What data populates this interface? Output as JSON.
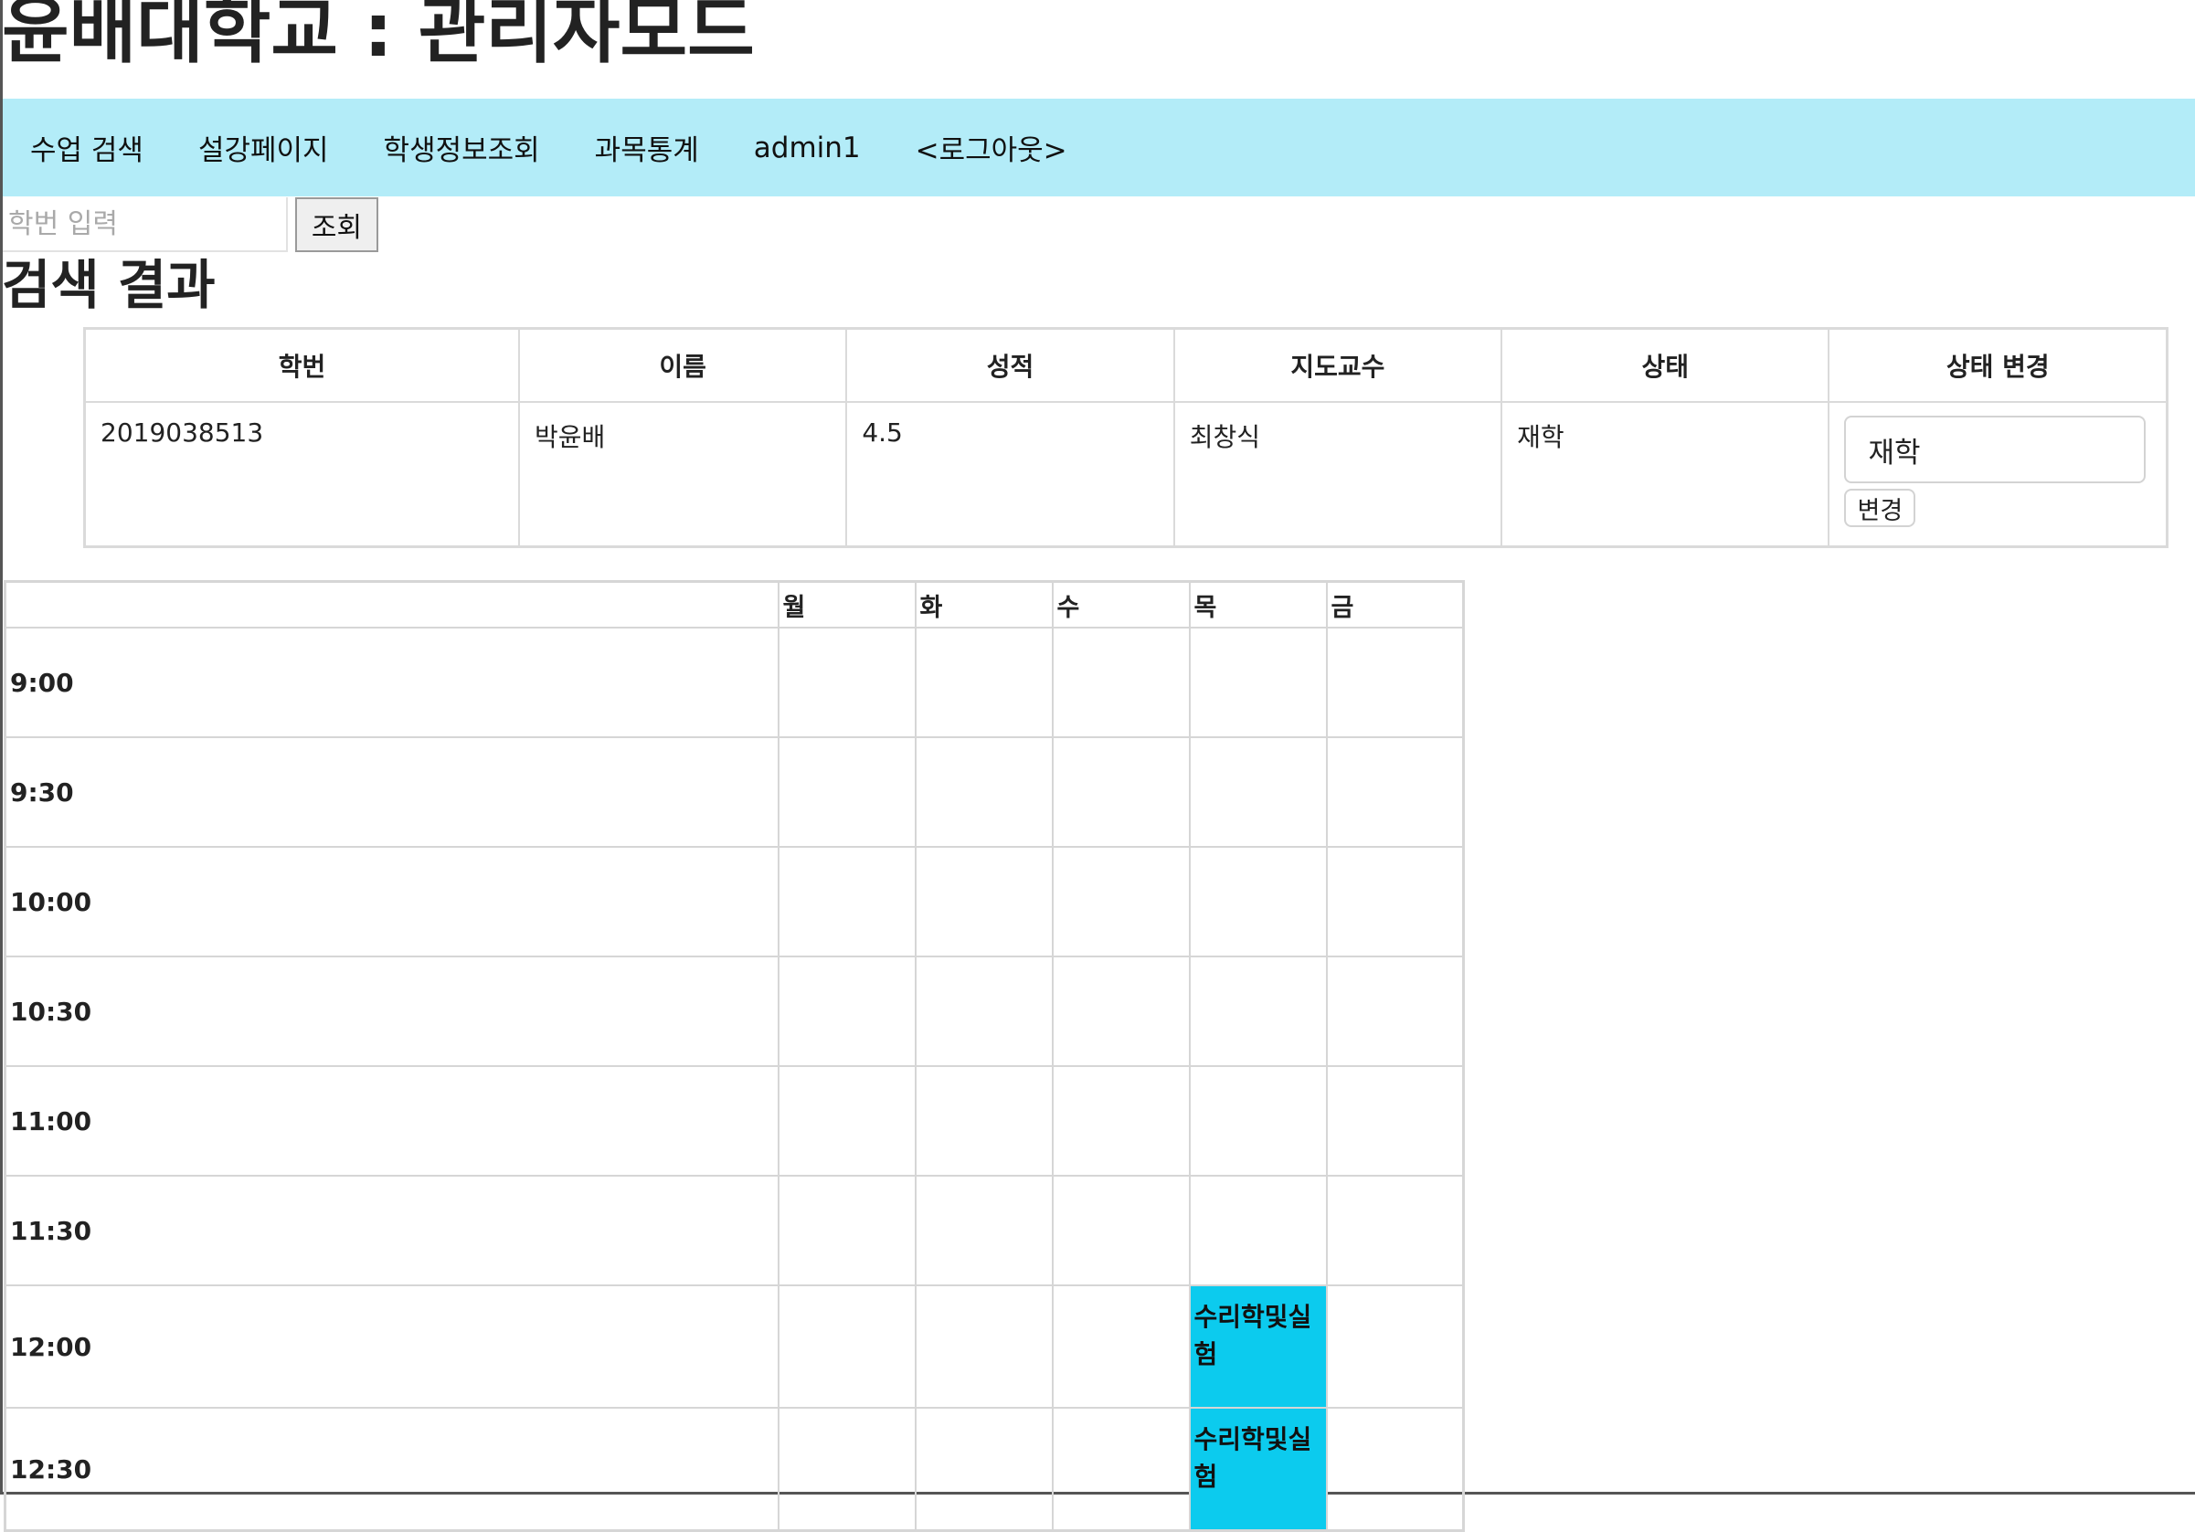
{
  "site_title": "윤배대학교 : 관리자모드",
  "nav": {
    "items": [
      "수업 검색",
      "설강페이지",
      "학생정보조회",
      "과목통계",
      "admin1",
      "<로그아웃>"
    ]
  },
  "search": {
    "placeholder": "학번 입력",
    "button_label": "조회"
  },
  "result_heading": "검색 결과",
  "student_table": {
    "headers": [
      "학번",
      "이름",
      "성적",
      "지도교수",
      "상태",
      "상태 변경"
    ],
    "row": {
      "student_id": "2019038513",
      "name": "박윤배",
      "grade": "4.5",
      "advisor": "최창식",
      "status": "재학",
      "status_field_value": "재학",
      "change_button": "변경"
    }
  },
  "timetable": {
    "days": [
      "월",
      "화",
      "수",
      "목",
      "금"
    ],
    "times": [
      "9:00",
      "9:30",
      "10:00",
      "10:30",
      "11:00",
      "11:30",
      "12:00",
      "12:30"
    ],
    "classes": [
      {
        "day": "목",
        "time": "12:00",
        "name": "수리학및실험"
      },
      {
        "day": "목",
        "time": "12:30",
        "name": "수리학및실험"
      }
    ],
    "class_color": "#0ccbee"
  },
  "colors": {
    "nav_background": "#b3ecf8",
    "class_highlight": "#0ccbee"
  }
}
